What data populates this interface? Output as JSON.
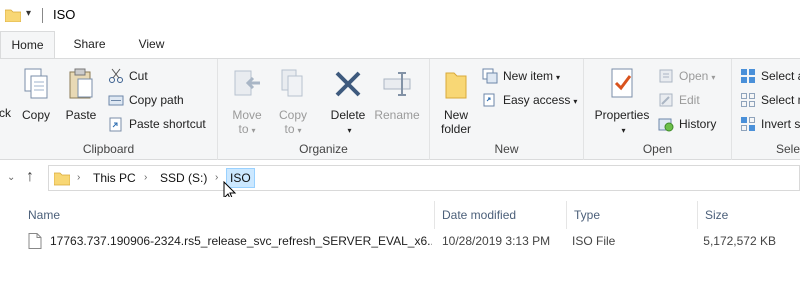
{
  "window": {
    "title": "ISO"
  },
  "tabs": [
    {
      "label": "Home",
      "active": true
    },
    {
      "label": "Share",
      "active": false
    },
    {
      "label": "View",
      "active": false
    }
  ],
  "ribbon": {
    "clipboard": {
      "label": "Clipboard",
      "pin_partial": "ck",
      "copy": "Copy",
      "paste": "Paste",
      "cut": "Cut",
      "copy_path": "Copy path",
      "paste_shortcut": "Paste shortcut"
    },
    "organize": {
      "label": "Organize",
      "move_to_1": "Move",
      "move_to_2": "to",
      "copy_to_1": "Copy",
      "copy_to_2": "to",
      "delete": "Delete",
      "rename": "Rename"
    },
    "new": {
      "label": "New",
      "new_folder_1": "New",
      "new_folder_2": "folder",
      "new_item": "New item",
      "easy_access": "Easy access"
    },
    "open": {
      "label": "Open",
      "properties": "Properties",
      "open": "Open",
      "edit": "Edit",
      "history": "History"
    },
    "select": {
      "label_partial": "Sele",
      "select_all_partial": "Select a",
      "select_none_partial": "Select n",
      "invert_partial": "Invert s"
    }
  },
  "address": {
    "crumbs": [
      "This PC",
      "SSD (S:)",
      "ISO"
    ]
  },
  "columns": {
    "name": "Name",
    "date": "Date modified",
    "type": "Type",
    "size": "Size"
  },
  "files": [
    {
      "name": "17763.737.190906-2324.rs5_release_svc_refresh_SERVER_EVAL_x6...",
      "date": "10/28/2019 3:13 PM",
      "type": "ISO File",
      "size": "5,172,572 KB"
    }
  ],
  "colors": {
    "accent": "#cce8ff",
    "ribbon_bg": "#f5f6f7",
    "folder_yellow": "#f8d775",
    "header_text": "#4c607a"
  },
  "icons": {
    "folder": "folder-icon",
    "up": "up-arrow-icon",
    "cut": "scissors-icon",
    "delete": "delete-x-icon",
    "properties": "properties-check-icon"
  }
}
